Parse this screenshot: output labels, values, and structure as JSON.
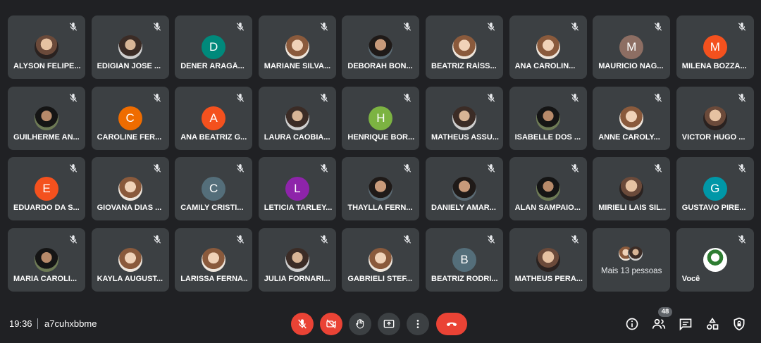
{
  "meeting": {
    "time": "19:36",
    "code": "a7cuhxbbme",
    "participant_count": "48"
  },
  "participants": [
    {
      "name": "ALYSON FELIPE...",
      "avatar": "photo",
      "initial": ""
    },
    {
      "name": "EDIGIAN JOSE ...",
      "avatar": "photo2",
      "initial": ""
    },
    {
      "name": "DENER ARAGÃ...",
      "avatar": "letter",
      "initial": "D",
      "color": "#00897b"
    },
    {
      "name": "MARIANE SILVA...",
      "avatar": "photo4",
      "initial": ""
    },
    {
      "name": "DEBORAH BON...",
      "avatar": "photo3",
      "initial": ""
    },
    {
      "name": "BEATRIZ RAÍSS...",
      "avatar": "photo4",
      "initial": ""
    },
    {
      "name": "ANA CAROLIN...",
      "avatar": "photo4",
      "initial": ""
    },
    {
      "name": "MAURICIO NAG...",
      "avatar": "letter",
      "initial": "M",
      "color": "#8d6e63"
    },
    {
      "name": "MILENA BOZZA...",
      "avatar": "letter",
      "initial": "M",
      "color": "#f4511e"
    },
    {
      "name": "GUILHERME AN...",
      "avatar": "photo5",
      "initial": ""
    },
    {
      "name": "CAROLINE FER...",
      "avatar": "letter",
      "initial": "C",
      "color": "#ef6c00"
    },
    {
      "name": "ANA BEATRIZ G...",
      "avatar": "letter",
      "initial": "A",
      "color": "#f4511e"
    },
    {
      "name": "LAURA CAOBIA...",
      "avatar": "photo2",
      "initial": ""
    },
    {
      "name": "HENRIQUE BOR...",
      "avatar": "letter",
      "initial": "H",
      "color": "#7cb342"
    },
    {
      "name": "MATHEUS ASSU...",
      "avatar": "photo2",
      "initial": ""
    },
    {
      "name": "ISABELLE DOS ...",
      "avatar": "photo5",
      "initial": ""
    },
    {
      "name": "ANNE CAROLY...",
      "avatar": "photo4",
      "initial": ""
    },
    {
      "name": "VICTOR HUGO ...",
      "avatar": "photo",
      "initial": ""
    },
    {
      "name": "EDUARDO DA S...",
      "avatar": "letter",
      "initial": "E",
      "color": "#f4511e"
    },
    {
      "name": "GIOVANA DIAS ...",
      "avatar": "photo4",
      "initial": ""
    },
    {
      "name": "CAMILY CRISTI...",
      "avatar": "letter",
      "initial": "C",
      "color": "#546e7a"
    },
    {
      "name": "LETICIA TARLEY...",
      "avatar": "letter",
      "initial": "L",
      "color": "#8e24aa"
    },
    {
      "name": "THAYLLA FERN...",
      "avatar": "photo3",
      "initial": ""
    },
    {
      "name": "DANIELY AMAR...",
      "avatar": "photo3",
      "initial": ""
    },
    {
      "name": "ALAN SAMPAIO...",
      "avatar": "photo5",
      "initial": ""
    },
    {
      "name": "MIRIELI LAIS SIL...",
      "avatar": "photo",
      "initial": ""
    },
    {
      "name": "GUSTAVO PIRE...",
      "avatar": "letter",
      "initial": "G",
      "color": "#0097a7"
    },
    {
      "name": "MARIA CAROLI...",
      "avatar": "photo5",
      "initial": ""
    },
    {
      "name": "KAYLA AUGUST...",
      "avatar": "photo4",
      "initial": ""
    },
    {
      "name": "LARISSA FERNA...",
      "avatar": "photo4",
      "initial": ""
    },
    {
      "name": "JULIA FORNARI...",
      "avatar": "photo2",
      "initial": ""
    },
    {
      "name": "GABRIELI STEF...",
      "avatar": "photo4",
      "initial": ""
    },
    {
      "name": "BEATRIZ RODRI...",
      "avatar": "letter",
      "initial": "B",
      "color": "#546e7a"
    },
    {
      "name": "MATHEUS PERA...",
      "avatar": "photo",
      "initial": ""
    },
    {
      "name": "Mais 13 pessoas",
      "avatar": "more",
      "initial": ""
    },
    {
      "name": "Você",
      "avatar": "photo6",
      "initial": ""
    }
  ],
  "controls": {
    "left": [
      "mic-off-icon",
      "camera-off-icon",
      "raise-hand-icon",
      "present-icon",
      "more-options-icon",
      "leave-call-icon"
    ],
    "right": [
      "info-icon",
      "people-icon",
      "chat-icon",
      "activities-icon",
      "host-controls-icon"
    ]
  },
  "colors": {
    "background": "#202124",
    "tile": "#3c4043",
    "danger": "#ea4335"
  }
}
